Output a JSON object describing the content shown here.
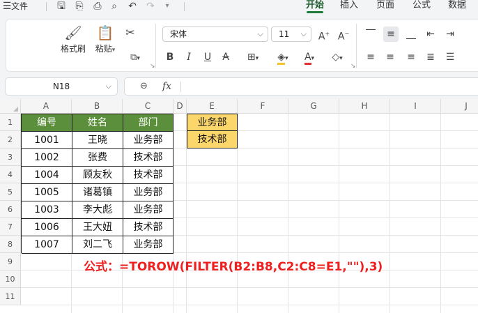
{
  "menubar": {
    "menu_label": "文件",
    "tabs": [
      "开始",
      "插入",
      "页面",
      "公式",
      "数据"
    ],
    "active_tab": "开始"
  },
  "ribbon": {
    "format_painter": "格式刷",
    "paste": "粘贴",
    "font_name": "宋体",
    "font_size": "11"
  },
  "formula_bar": {
    "name_box": "N18",
    "fx": "fx",
    "content": ""
  },
  "columns": [
    "A",
    "B",
    "C",
    "D",
    "E",
    "F",
    "G",
    "H",
    "I",
    "J"
  ],
  "rows": [
    "1",
    "2",
    "3",
    "4",
    "5",
    "6",
    "7",
    "8",
    "9",
    "10",
    "11"
  ],
  "table": {
    "headers": [
      "编号",
      "姓名",
      "部门"
    ],
    "rows": [
      [
        "1001",
        "王晓",
        "业务部"
      ],
      [
        "1002",
        "张费",
        "技术部"
      ],
      [
        "1004",
        "顾友秋",
        "技术部"
      ],
      [
        "1005",
        "诸葛镇",
        "业务部"
      ],
      [
        "1003",
        "李大彪",
        "业务部"
      ],
      [
        "1006",
        "王大妞",
        "技术部"
      ],
      [
        "1007",
        "刘二飞",
        "业务部"
      ]
    ]
  },
  "criteria": [
    "业务部",
    "技术部"
  ],
  "note": "公式：=TOROW(FILTER(B2:B8,C2:C8=E1,\"\"),3)",
  "colors": {
    "header_fill": "#5b8f3b",
    "criteria_fill": "#fbd66b",
    "note_color": "#ee1f1f",
    "accent": "#1f7a3d"
  }
}
